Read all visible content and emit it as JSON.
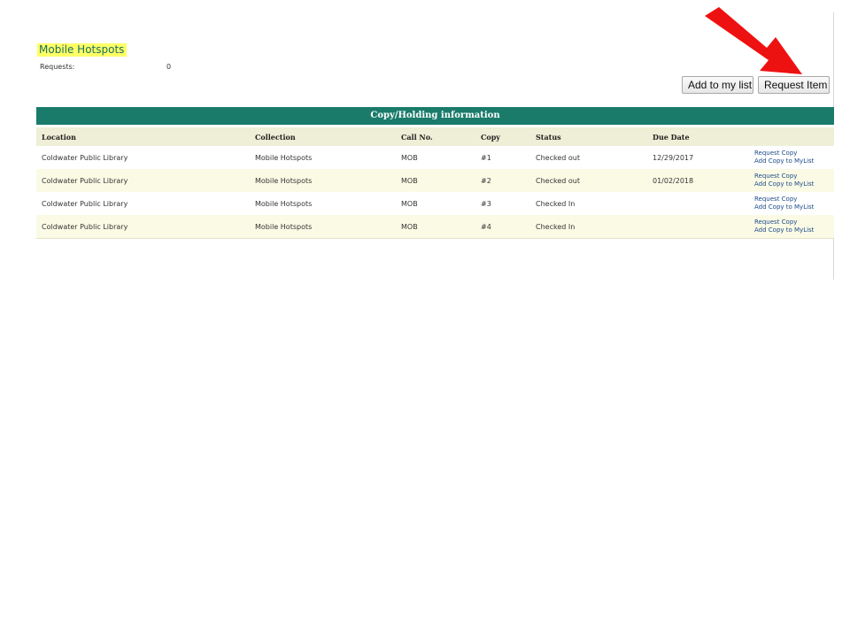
{
  "item": {
    "title": "Mobile Hotspots",
    "requests_label": "Requests:",
    "requests_value": "0"
  },
  "buttons": {
    "add_to_list": "Add to my list",
    "request_item": "Request Item"
  },
  "annotation": {
    "arrow_color": "#ee1111"
  },
  "holdings": {
    "caption": "Copy/Holding information",
    "columns": [
      "Location",
      "Collection",
      "Call No.",
      "Copy",
      "Status",
      "Due Date"
    ],
    "rows": [
      {
        "location": "Coldwater Public Library",
        "collection": "Mobile Hotspots",
        "call_no": "MOB",
        "copy": "#1",
        "status": "Checked out",
        "due_date": "12/29/2017",
        "link_request": "Request Copy",
        "link_add": "Add Copy to MyList"
      },
      {
        "location": "Coldwater Public Library",
        "collection": "Mobile Hotspots",
        "call_no": "MOB",
        "copy": "#2",
        "status": "Checked out",
        "due_date": "01/02/2018",
        "link_request": "Request Copy",
        "link_add": "Add Copy to MyList"
      },
      {
        "location": "Coldwater Public Library",
        "collection": "Mobile Hotspots",
        "call_no": "MOB",
        "copy": "#3",
        "status": "Checked In",
        "due_date": "",
        "link_request": "Request Copy",
        "link_add": "Add Copy to MyList"
      },
      {
        "location": "Coldwater Public Library",
        "collection": "Mobile Hotspots",
        "call_no": "MOB",
        "copy": "#4",
        "status": "Checked In",
        "due_date": "",
        "link_request": "Request Copy",
        "link_add": "Add Copy to MyList"
      }
    ]
  },
  "colors": {
    "header_bar": "#1a7b6b",
    "column_header_bg": "#efeed6",
    "title_highlight": "#ffff66"
  }
}
